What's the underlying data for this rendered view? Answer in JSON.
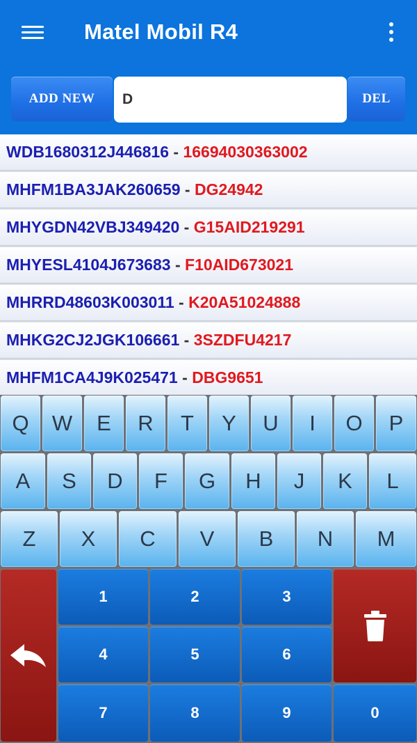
{
  "app": {
    "title": "Matel Mobil R4",
    "menu_icon": "hamburger-menu-icon",
    "overflow_icon": "more-vertical-icon"
  },
  "input_row": {
    "add_label": "ADD NEW",
    "search_value": "D",
    "del_label": "DEL"
  },
  "list": [
    {
      "vin": "WDB1680312J446816",
      "sep": " - ",
      "plate": "16694030363002"
    },
    {
      "vin": "MHFM1BA3JAK260659",
      "sep": " - ",
      "plate": "DG24942"
    },
    {
      "vin": "MHYGDN42VBJ349420",
      "sep": " - ",
      "plate": "G15AID219291"
    },
    {
      "vin": "MHYESL4104J673683",
      "sep": " - ",
      "plate": "F10AID673021"
    },
    {
      "vin": "MHRRD48603K003011",
      "sep": " - ",
      "plate": "K20A51024888"
    },
    {
      "vin": "MHKG2CJ2JGK106661",
      "sep": " - ",
      "plate": "3SZDFU4217"
    },
    {
      "vin": "MHFM1CA4J9K025471",
      "sep": " - ",
      "plate": "DBG9651"
    }
  ],
  "keyboard": {
    "row1": [
      "Q",
      "W",
      "E",
      "R",
      "T",
      "Y",
      "U",
      "I",
      "O",
      "P"
    ],
    "row2": [
      "A",
      "S",
      "D",
      "F",
      "G",
      "H",
      "J",
      "K",
      "L"
    ],
    "row3": [
      "Z",
      "X",
      "C",
      "V",
      "B",
      "N",
      "M"
    ],
    "numbers": [
      "1",
      "2",
      "3",
      "4",
      "5",
      "6",
      "7",
      "8",
      "9",
      "0"
    ],
    "back_icon": "back-arrow-icon",
    "delete_icon": "trash-icon"
  }
}
